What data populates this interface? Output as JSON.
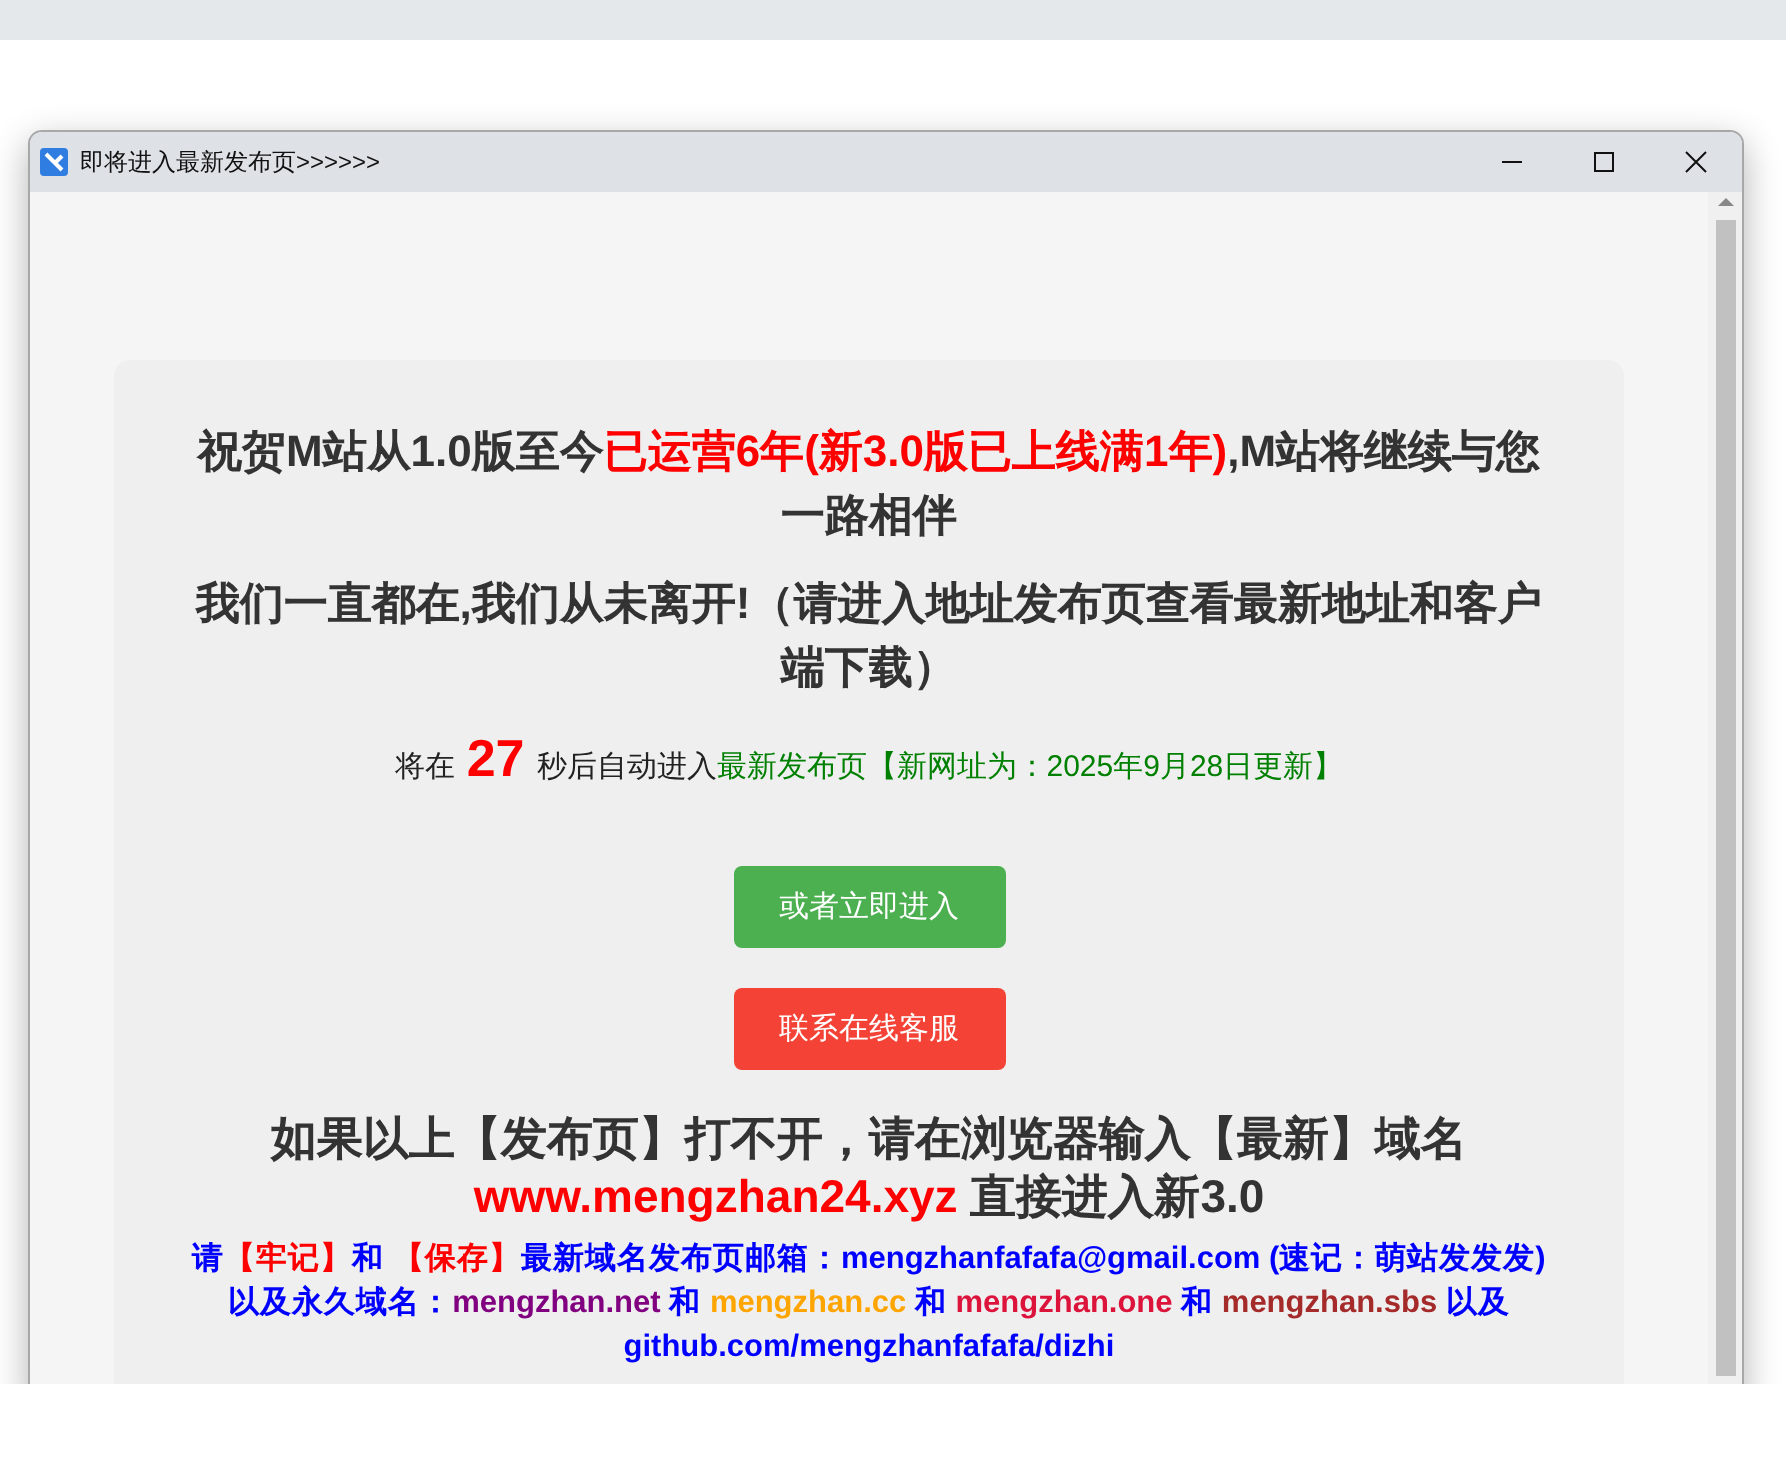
{
  "window": {
    "title": "即将进入最新发布页",
    "title_suffix": ">>>>>>"
  },
  "headings": [
    {
      "segments": [
        {
          "text": "祝贺M站从1.0版至今",
          "color": "#333333"
        },
        {
          "text": "已运营6年(新3.0版已上线满1年)",
          "color": "#ff0000"
        },
        {
          "text": ",M站将继续与您一路相伴",
          "color": "#333333"
        }
      ]
    },
    {
      "segments": [
        {
          "text": "我们一直都在,我们从未离开!（请进入地址发布页查看最新地址和客户端下载）",
          "color": "#333333"
        }
      ]
    }
  ],
  "countdown": {
    "before": "将在",
    "seconds": "27",
    "after": "秒后自动进入",
    "link": "最新发布页",
    "note": "【新网址为：2025年9月28日更新】"
  },
  "buttons": [
    {
      "label": "或者立即进入",
      "color": "#4caf50"
    },
    {
      "label": "联系在线客服",
      "color": "#f44336"
    }
  ],
  "fallback": {
    "heading": "如果以上【发布页】打不开，请在浏览器输入【最新】域名",
    "url": "www.mengzhan24.xyz",
    "url_after": "直接进入新3.0"
  },
  "notice": [
    {
      "text": "请",
      "color": "#0000ff"
    },
    {
      "text": "【牢记】",
      "color": "#ff0000"
    },
    {
      "text": "和 ",
      "color": "#0000ff"
    },
    {
      "text": "【保存】",
      "color": "#ff0000"
    },
    {
      "text": "最新域名发布页邮箱：mengzhanfafafa@gmail.com (速记：萌站发发发) 以及永久域名：",
      "color": "#0000ff"
    },
    {
      "text": "mengzhan.net",
      "color": "#800080"
    },
    {
      "text": " 和 ",
      "color": "#0000ff"
    },
    {
      "text": "mengzhan.cc",
      "color": "#ffa500"
    },
    {
      "text": " 和 ",
      "color": "#0000ff"
    },
    {
      "text": "mengzhan.one",
      "color": "#dc143c"
    },
    {
      "text": " 和 ",
      "color": "#0000ff"
    },
    {
      "text": "mengzhan.sbs",
      "color": "#a52a2a"
    },
    {
      "text": " 以及 github.com/mengzhanfafafa/dizhi",
      "color": "#0000ff"
    }
  ]
}
